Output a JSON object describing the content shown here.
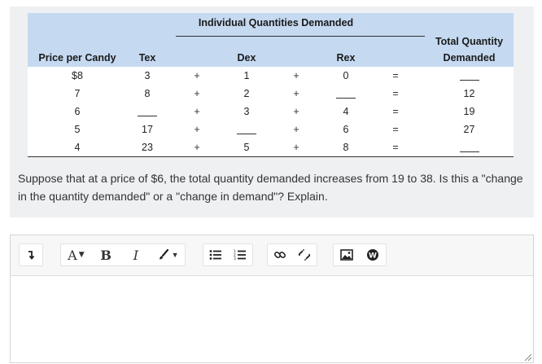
{
  "table": {
    "group_header": "Individual Quantities Demanded",
    "total_header_line1": "Total Quantity",
    "total_header_line2": "Demanded",
    "col_price": "Price per Candy",
    "col_tex": "Tex",
    "col_dex": "Dex",
    "col_rex": "Rex",
    "plus": "+",
    "equals": "=",
    "rows": [
      {
        "price": "$8",
        "tex": "3",
        "dex": "1",
        "rex": "0",
        "total": ""
      },
      {
        "price": "7",
        "tex": "8",
        "dex": "2",
        "rex": "",
        "total": "12"
      },
      {
        "price": "6",
        "tex": "",
        "dex": "3",
        "rex": "4",
        "total": "19"
      },
      {
        "price": "5",
        "tex": "17",
        "dex": "",
        "rex": "6",
        "total": "27"
      },
      {
        "price": "4",
        "tex": "23",
        "dex": "5",
        "rex": "8",
        "total": ""
      }
    ]
  },
  "question": "Suppose that at a price of $6, the total quantity demanded increases from 19 to 38. Is this a \"change in the quantity demanded\" or a \"change in demand\"? Explain.",
  "toolbar": {
    "font_label": "A",
    "bold_label": "B",
    "italic_label": "I"
  },
  "icons": [
    "format-arrow-icon",
    "font-size-icon",
    "bold-icon",
    "italic-icon",
    "brush-icon",
    "bullet-list-icon",
    "numbered-list-icon",
    "link-icon",
    "unlink-icon",
    "image-icon",
    "wiris-icon"
  ],
  "colors": {
    "table_header": "#c5d9f1",
    "card_bg": "#eef0f2"
  }
}
